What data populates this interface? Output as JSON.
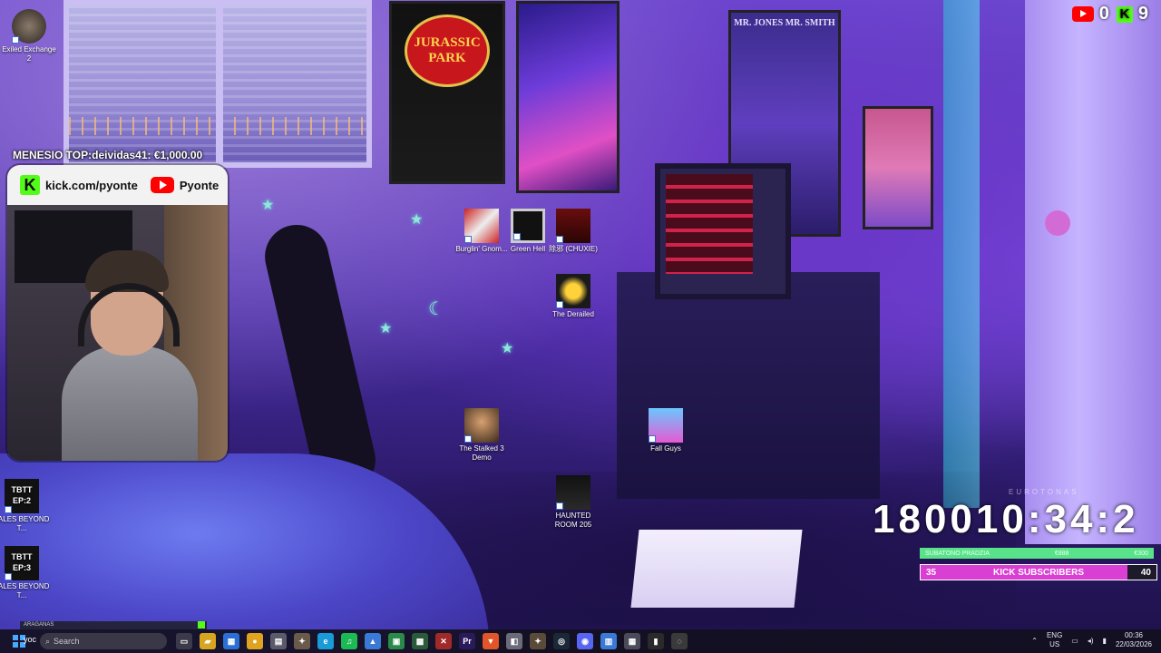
{
  "desktop_icons": [
    {
      "id": "exiled",
      "label": "Exiled Exchange 2"
    },
    {
      "id": "burglin",
      "label": "Burglin' Gnom..."
    },
    {
      "id": "greenhell",
      "label": "Green Hell"
    },
    {
      "id": "chuxie",
      "label": "除邪 (CHUXIE)"
    },
    {
      "id": "derailed",
      "label": "The Derailed"
    },
    {
      "id": "stalked",
      "label": "The Stalked 3 Demo"
    },
    {
      "id": "fallguys",
      "label": "Fall Guys"
    },
    {
      "id": "haunted",
      "label": "HAUNTED ROOM 205"
    },
    {
      "id": "tbtt2",
      "label": "TALES BEYOND T...",
      "art": "TBTT EP:2"
    },
    {
      "id": "tbtt3",
      "label": "TALES BEYOND T...",
      "art": "TBTT EP:3"
    }
  ],
  "room": {
    "poster_jp": "JURASSIC PARK",
    "poster_mib": "MR. JONES   MR. SMITH"
  },
  "overlay": {
    "top_donor": "MENESIO TOP:deividas41: €1,000.00",
    "kick_url": "kick.com/pyonte",
    "yt_name": "Pyonte",
    "yt_count": "0",
    "kick_count": "9",
    "timer": "180010:34:2",
    "watermark": "EUROTONAS",
    "goal1_left": "SUBATONO PRADZIA",
    "goal1_mid": "€888",
    "goal1_right": "€300",
    "goal2_current": "35",
    "goal2_label": "KICK SUBSCRIBERS",
    "goal2_max": "40",
    "goal2_progress": 0.875
  },
  "taskbar": {
    "notif": "ARAGANAS",
    "yoc": "yoc",
    "search_placeholder": "Search",
    "apps": [
      {
        "id": "taskview",
        "glyph": "▭",
        "color": "#3a3a4a"
      },
      {
        "id": "explorer",
        "glyph": "▰",
        "color": "#d7a520"
      },
      {
        "id": "store",
        "glyph": "▦",
        "color": "#2b6fd6"
      },
      {
        "id": "chrome",
        "glyph": "●",
        "color": "#e0a321"
      },
      {
        "id": "files",
        "glyph": "▤",
        "color": "#5a5a6a"
      },
      {
        "id": "game1",
        "glyph": "✦",
        "color": "#6a5a4a"
      },
      {
        "id": "edge",
        "glyph": "e",
        "color": "#1a9ad6"
      },
      {
        "id": "spotify",
        "glyph": "♫",
        "color": "#1db954"
      },
      {
        "id": "photos",
        "glyph": "▲",
        "color": "#3a7ad6"
      },
      {
        "id": "app1",
        "glyph": "▣",
        "color": "#2a8a4a"
      },
      {
        "id": "app2",
        "glyph": "▩",
        "color": "#2a5a3a"
      },
      {
        "id": "app3",
        "glyph": "✕",
        "color": "#a02a2a"
      },
      {
        "id": "premiere",
        "glyph": "Pr",
        "color": "#2a1a5a"
      },
      {
        "id": "brave",
        "glyph": "▼",
        "color": "#e0552a"
      },
      {
        "id": "app4",
        "glyph": "◧",
        "color": "#6a6a7a"
      },
      {
        "id": "game2",
        "glyph": "✦",
        "color": "#5a4a3a"
      },
      {
        "id": "steam",
        "glyph": "◎",
        "color": "#1b2838"
      },
      {
        "id": "discord",
        "glyph": "◉",
        "color": "#5865f2"
      },
      {
        "id": "notepad",
        "glyph": "▥",
        "color": "#3a7ad6"
      },
      {
        "id": "calc",
        "glyph": "▦",
        "color": "#4a4a5a"
      },
      {
        "id": "terminal",
        "glyph": "▮",
        "color": "#2a2a2a"
      },
      {
        "id": "obs",
        "glyph": "◌",
        "color": "#3a3a3a"
      }
    ],
    "lang_top": "ENG",
    "lang_bottom": "US",
    "time": "00:36",
    "date": "22/03/2026"
  }
}
